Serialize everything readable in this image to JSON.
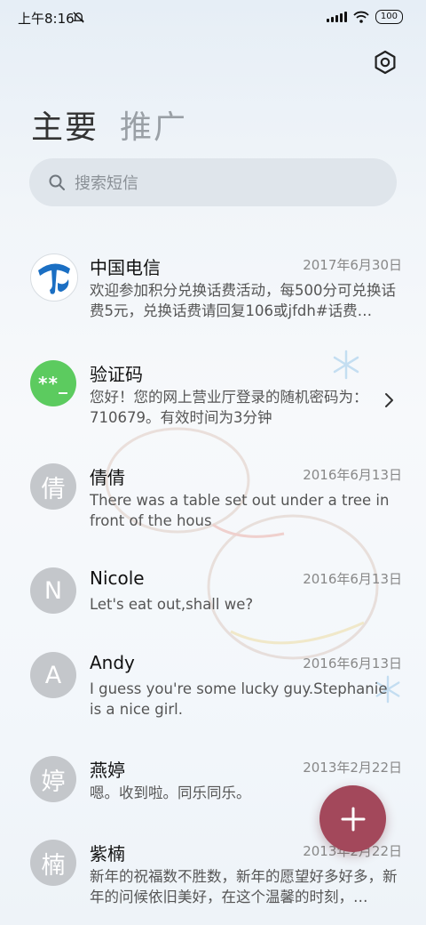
{
  "status_bar": {
    "time": "上午8:16",
    "battery": "100"
  },
  "tabs": [
    {
      "label": "主要"
    },
    {
      "label": "推广"
    }
  ],
  "search": {
    "placeholder": "搜索短信"
  },
  "messages": [
    {
      "sender": "中国电信",
      "date": "2017年6月30日",
      "preview": "欢迎参加积分兑换话费活动，每500分可兑换话费5元，兑换话费请回复106或jfdh#话费…",
      "avatar_type": "logo",
      "avatar_icon": "china-telecom-logo"
    },
    {
      "sender": "验证码",
      "date": "",
      "preview": "您好！您的网上营业厅登录的随机密码为：710679。有效时间为3分钟",
      "avatar_type": "icon",
      "avatar_text": "**_",
      "avatar_color": "#5ccb5f"
    },
    {
      "sender": "倩倩",
      "date": "2016年6月13日",
      "preview": "There was a table set out under a tree in front of the hous",
      "avatar_type": "letter",
      "avatar_text": "倩"
    },
    {
      "sender": "Nicole",
      "date": "2016年6月13日",
      "preview": "Let's eat out,shall we?",
      "avatar_type": "letter",
      "avatar_text": "N"
    },
    {
      "sender": "Andy",
      "date": "2016年6月13日",
      "preview": "I guess you're some lucky guy.Stephanie is a nice girl.",
      "avatar_type": "letter",
      "avatar_text": "A"
    },
    {
      "sender": "燕婷",
      "date": "2013年2月22日",
      "preview": "嗯。收到啦。同乐同乐。",
      "avatar_type": "letter",
      "avatar_text": "婷"
    },
    {
      "sender": "紫楠",
      "date": "2013年2月22日",
      "preview": "新年的祝福数不胜数，新年的愿望好多好多，新年的问候依旧美好，在这个温馨的时刻，…",
      "avatar_type": "letter",
      "avatar_text": "楠"
    }
  ],
  "colors": {
    "fab": "#a3485b",
    "verify_avatar": "#5ccb5f",
    "telecom_blue": "#1b6fc3"
  },
  "icons": {
    "settings": "settings-hexagon-icon",
    "search": "search-icon",
    "compose": "plus-icon"
  }
}
